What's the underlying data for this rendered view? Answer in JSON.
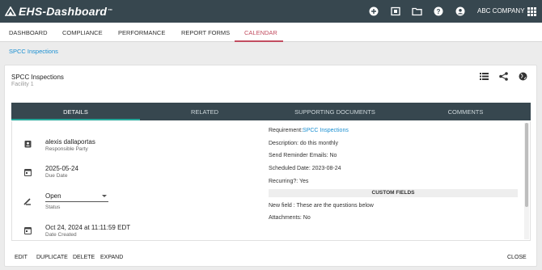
{
  "app": {
    "logo_text": "EHS-Dashboard",
    "logo_mark": "™",
    "company": "ABC COMPANY",
    "top_icons": [
      "plus-circle-icon",
      "document-icon",
      "folder-icon",
      "help-icon",
      "account-icon",
      "apps-grid-icon"
    ]
  },
  "nav": {
    "items": [
      "DASHBOARD",
      "COMPLIANCE",
      "PERFORMANCE",
      "REPORT FORMS",
      "CALENDAR"
    ],
    "active": "CALENDAR"
  },
  "breadcrumb": "SPCC Inspections",
  "record": {
    "title": "SPCC Inspections",
    "subtitle": "Facility 1"
  },
  "tabs": [
    "DETAILS",
    "RELATED",
    "SUPPORTING DOCUMENTS",
    "COMMENTS"
  ],
  "left_fields": {
    "responsible": {
      "value": "alexis dallaportas",
      "label": "Responsible Party"
    },
    "due": {
      "value": "2025-05-24",
      "label": "Due Date"
    },
    "status": {
      "value": "Open",
      "label": "Status"
    },
    "created": {
      "value": "Oct 24, 2024 at 11:11:59 EDT",
      "label": "Date Created"
    }
  },
  "right_fields": {
    "requirement_label": "Requirement:",
    "requirement_value": "SPCC Inspections",
    "description": "Description: do this monthly",
    "reminder": "Send Reminder Emails: No",
    "scheduled": "Scheduled Date: 2023-08-24",
    "recurring": "Recurring?: Yes",
    "custom_header": "CUSTOM FIELDS",
    "new_field": "New field : These are the questions below",
    "attachments": "Attachments: No"
  },
  "actions": {
    "edit": "EDIT",
    "duplicate": "DUPLICATE",
    "delete": "DELETE",
    "expand": "EXPAND",
    "close": "CLOSE"
  },
  "colors": {
    "topbar": "#37474f",
    "accent_nav": "#c24d60",
    "link": "#1a8fd1",
    "tab_underline": "#26a69a"
  }
}
